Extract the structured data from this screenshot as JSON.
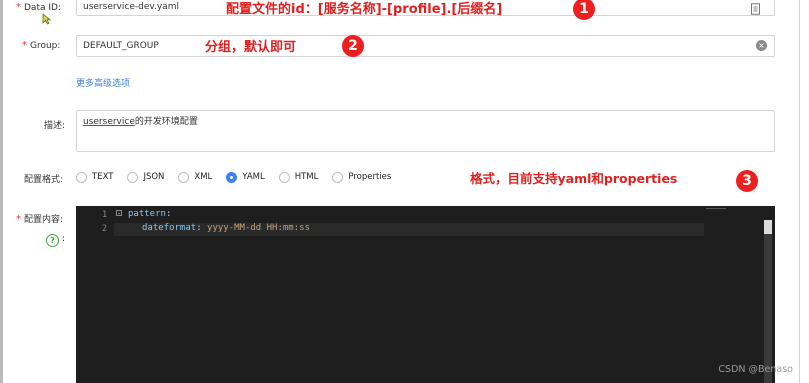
{
  "form": {
    "data_id": {
      "label": "Data ID:",
      "value": "userservice-dev.yaml",
      "annotation": "配置文件的id：[服务名称]-[profile].[后缀名]",
      "badge": "1"
    },
    "group": {
      "label": "Group:",
      "value": "DEFAULT_GROUP",
      "annotation": "分组，默认即可",
      "badge": "2"
    },
    "more_options_link": "更多高级选项",
    "description": {
      "label": "描述:",
      "value_link": "userservice",
      "value_rest": "的开发环境配置"
    },
    "format": {
      "label": "配置格式:",
      "options": [
        "TEXT",
        "JSON",
        "XML",
        "YAML",
        "HTML",
        "Properties"
      ],
      "selected": "YAML",
      "annotation": "格式，目前支持yaml和properties",
      "badge": "3"
    },
    "content": {
      "label": "配置内容:",
      "help_colon": ":"
    }
  },
  "editor": {
    "lines": [
      {
        "num": "1",
        "key": "pattern",
        "sep": ":",
        "value": ""
      },
      {
        "num": "2",
        "key": "dateformat",
        "sep": ": ",
        "value": "yyyy-MM-dd HH:mm:ss"
      }
    ]
  },
  "watermark": "CSDN @Benaso",
  "colors": {
    "required": "#e0393e",
    "link": "#3b7fd6",
    "annotation": "#e02020",
    "radio_selected": "#3b82f6",
    "editor_bg": "#1e1e1e",
    "yaml_key": "#7ec9f2",
    "yaml_value": "#c2a27a"
  }
}
